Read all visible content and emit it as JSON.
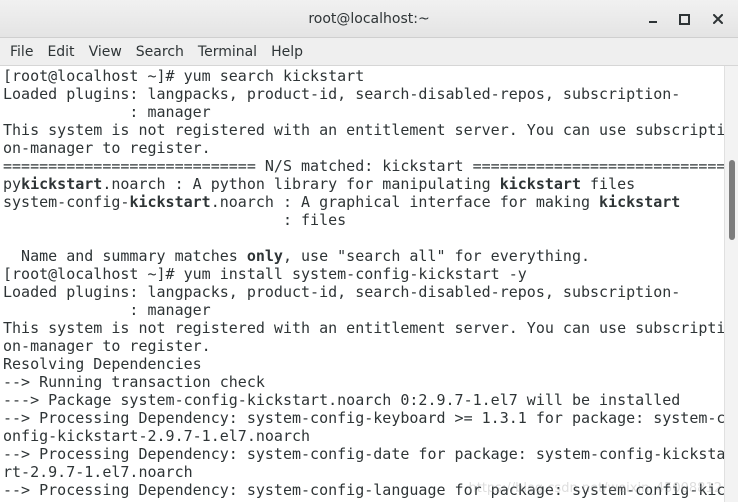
{
  "window": {
    "title": "root@localhost:~"
  },
  "menu": {
    "items": [
      "File",
      "Edit",
      "View",
      "Search",
      "Terminal",
      "Help"
    ]
  },
  "terminal": {
    "lines": [
      [
        {
          "t": "[root@localhost ~]# yum search kickstart"
        }
      ],
      [
        {
          "t": "Loaded plugins: langpacks, product-id, search-disabled-repos, subscription-"
        }
      ],
      [
        {
          "t": "              : manager"
        }
      ],
      [
        {
          "t": "This system is not registered with an entitlement server. You can use subscripti"
        }
      ],
      [
        {
          "t": "on-manager to register."
        }
      ],
      [
        {
          "t": "============================ N/S matched: kickstart ============================="
        }
      ],
      [
        {
          "t": "py"
        },
        {
          "t": "kickstart",
          "b": true
        },
        {
          "t": ".noarch : A python library for manipulating "
        },
        {
          "t": "kickstart",
          "b": true
        },
        {
          "t": " files"
        }
      ],
      [
        {
          "t": "system-config-"
        },
        {
          "t": "kickstart",
          "b": true
        },
        {
          "t": ".noarch : A graphical interface for making "
        },
        {
          "t": "kickstart",
          "b": true
        }
      ],
      [
        {
          "t": "                               : files"
        }
      ],
      [
        {
          "t": ""
        }
      ],
      [
        {
          "t": "  Name and summary matches "
        },
        {
          "t": "only",
          "b": true
        },
        {
          "t": ", use \"search all\" for everything."
        }
      ],
      [
        {
          "t": "[root@localhost ~]# yum install system-config-kickstart -y"
        }
      ],
      [
        {
          "t": "Loaded plugins: langpacks, product-id, search-disabled-repos, subscription-"
        }
      ],
      [
        {
          "t": "              : manager"
        }
      ],
      [
        {
          "t": "This system is not registered with an entitlement server. You can use subscripti"
        }
      ],
      [
        {
          "t": "on-manager to register."
        }
      ],
      [
        {
          "t": "Resolving Dependencies"
        }
      ],
      [
        {
          "t": "--> Running transaction check"
        }
      ],
      [
        {
          "t": "---> Package system-config-kickstart.noarch 0:2.9.7-1.el7 will be installed"
        }
      ],
      [
        {
          "t": "--> Processing Dependency: system-config-keyboard >= 1.3.1 for package: system-c"
        }
      ],
      [
        {
          "t": "onfig-kickstart-2.9.7-1.el7.noarch"
        }
      ],
      [
        {
          "t": "--> Processing Dependency: system-config-date for package: system-config-kicksta"
        }
      ],
      [
        {
          "t": "rt-2.9.7-1.el7.noarch"
        }
      ],
      [
        {
          "t": "--> Processing Dependency: system-config-language for package: system-config-kic"
        }
      ]
    ]
  },
  "colors": {
    "text": "#2e3436",
    "background": "#ffffff",
    "titlebar": "#e8e8e8",
    "menubar": "#efefef"
  },
  "icons": {
    "minimize": "minimize-icon",
    "maximize": "maximize-icon",
    "close": "close-icon"
  },
  "overlay": {
    "watermark": "https://blog.csdn.net/weixin_45008812"
  }
}
